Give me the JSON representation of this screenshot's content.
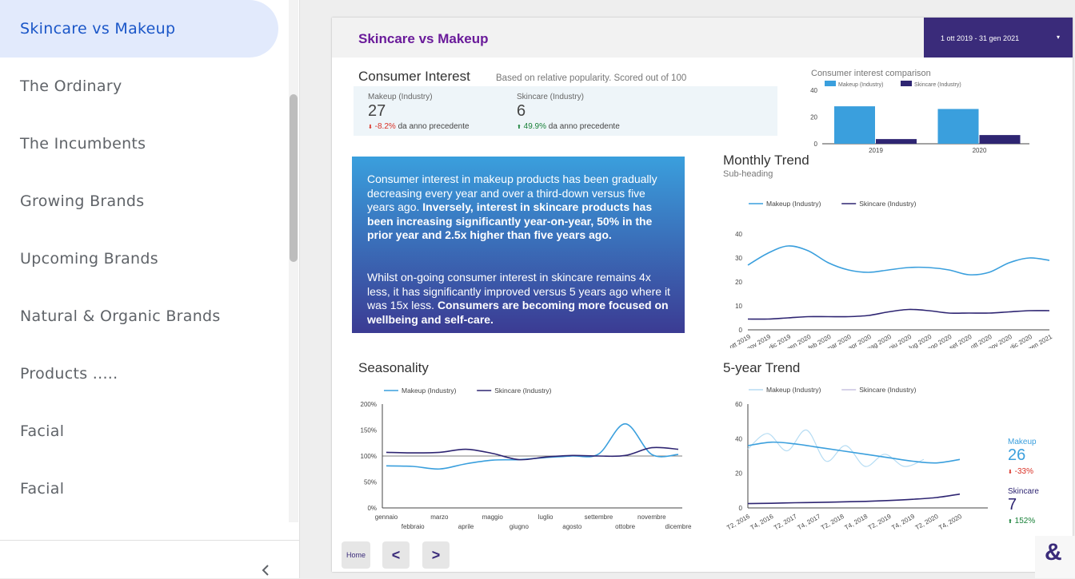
{
  "sidebar": {
    "items": [
      {
        "label": "Skincare vs Makeup",
        "active": true
      },
      {
        "label": "The Ordinary"
      },
      {
        "label": "The Incumbents"
      },
      {
        "label": "Growing Brands"
      },
      {
        "label": "Upcoming Brands"
      },
      {
        "label": "Natural & Organic Brands"
      },
      {
        "label": "Products ....."
      },
      {
        "label": "Facial"
      },
      {
        "label": "Facial"
      }
    ],
    "collapse_icon": "chevron-left-icon"
  },
  "report": {
    "title": "Skincare vs Makeup",
    "date_range": "1 ott 2019 - 31 gen 2021",
    "date_arrow": "▾",
    "consumer_interest": {
      "title": "Consumer Interest",
      "subtitle": "Based on relative popularity. Scored out of 100",
      "makeup": {
        "label": "Makeup (Industry)",
        "value": "27",
        "arrow": "⬇",
        "change": "-8.2%",
        "suffix": "da anno precedente"
      },
      "skincare": {
        "label": "Skincare (Industry)",
        "value": "6",
        "arrow": "⬆",
        "change": "49.9%",
        "suffix": "da anno precedente"
      }
    },
    "insight": {
      "p1_normal": "Consumer interest in makeup products has been gradually decreasing every year and over a third-down versus five years ago.",
      "p1_bold": "Inversely, interest in skincare products has been increasing significantly year-on-year, 50% in the prior year and 2.5x higher than five years ago.",
      "p2_normal": "Whilst on-going consumer interest in skincare remains 4x less, it has significantly improved versus 5 years ago where it was 15x less.",
      "p2_bold": "Consumers are becoming more focused on wellbeing and self-care."
    },
    "buttons": {
      "home": "Home",
      "prev": "<",
      "next": ">"
    },
    "logo": "&",
    "five_year_kpis": {
      "makeup_label": "Makeup",
      "makeup_value": "26",
      "makeup_arrow": "⬇",
      "makeup_change": "-33%",
      "skincare_label": "Skincare",
      "skincare_value": "7",
      "skincare_arrow": "⬆",
      "skincare_change": "152%"
    }
  },
  "colors": {
    "makeup": "#3a9fdd",
    "skincare": "#2e2572",
    "accent": "#3a2b7a",
    "title": "#6a1b9a"
  },
  "chart_data": [
    {
      "type": "bar",
      "title": "Consumer interest comparison",
      "categories": [
        "2019",
        "2020"
      ],
      "series": [
        {
          "name": "Makeup (Industry)",
          "values": [
            28,
            26
          ]
        },
        {
          "name": "Skincare (Industry)",
          "values": [
            3.5,
            6.5
          ]
        }
      ],
      "yticks": [
        "0",
        "20",
        "40"
      ],
      "ylim": [
        0,
        40
      ],
      "legend": "top"
    },
    {
      "type": "line",
      "title": "Monthly Trend",
      "subtitle": "Sub-heading",
      "categories": [
        "ott 2019",
        "nov 2019",
        "dic 2019",
        "gen 2020",
        "feb 2020",
        "mar 2020",
        "apr 2020",
        "mag 2020",
        "giu 2020",
        "lug 2020",
        "ago 2020",
        "set 2020",
        "ott 2020",
        "nov 2020",
        "dic 2020",
        "gen 2021"
      ],
      "series": [
        {
          "name": "Makeup (Industry)",
          "values": [
            27,
            32,
            35,
            33,
            28,
            25,
            24,
            25,
            26,
            26,
            25,
            23,
            24,
            28,
            30,
            29
          ]
        },
        {
          "name": "Skincare (Industry)",
          "values": [
            4.5,
            4.5,
            5,
            5.5,
            5.5,
            5.5,
            6,
            7.5,
            8.5,
            8,
            7,
            7,
            7,
            7.5,
            8,
            8
          ]
        }
      ],
      "yticks": [
        "0",
        "10",
        "20",
        "30",
        "40"
      ],
      "ylim": [
        0,
        40
      ],
      "legend": "top"
    },
    {
      "type": "line",
      "title": "Seasonality",
      "categories": [
        "gennaio",
        "febbraio",
        "marzo",
        "aprile",
        "maggio",
        "giugno",
        "luglio",
        "agosto",
        "settembre",
        "ottobre",
        "novembre",
        "dicembre"
      ],
      "series": [
        {
          "name": "Makeup (Industry)",
          "values": [
            81,
            80,
            75,
            85,
            92,
            93,
            97,
            100,
            104,
            162,
            103,
            103
          ]
        },
        {
          "name": "Skincare (Industry)",
          "values": [
            107,
            106,
            107,
            113,
            105,
            93,
            98,
            101,
            100,
            101,
            116,
            113
          ]
        }
      ],
      "yticks": [
        "0%",
        "50%",
        "100%",
        "150%",
        "200%"
      ],
      "ylim": [
        0,
        200
      ],
      "legend": "top"
    },
    {
      "type": "line",
      "title": "5-year Trend",
      "categories": [
        "T2, 2016",
        "T4, 2016",
        "T2, 2017",
        "T4, 2017",
        "T2, 2018",
        "T4, 2018",
        "T2, 2019",
        "T4, 2019",
        "T2, 2020",
        "T4, 2020"
      ],
      "series": [
        {
          "name": "Makeup (Industry)",
          "values": [
            36,
            38,
            37,
            35,
            33,
            31,
            29,
            27,
            26,
            28
          ]
        },
        {
          "name": "Skincare (Industry)",
          "values": [
            2.5,
            2.7,
            3,
            3.2,
            3.5,
            3.8,
            4.3,
            5,
            6,
            8
          ]
        },
        {
          "name": "Makeup (Industry) raw",
          "values": [
            34,
            43,
            33,
            45,
            27,
            36,
            24,
            31,
            24,
            28
          ]
        }
      ],
      "legend_labels": [
        "Makeup (Industry)",
        "Skincare (Industry)"
      ],
      "yticks": [
        "0",
        "20",
        "40",
        "60"
      ],
      "ylim": [
        0,
        60
      ],
      "legend": "top"
    }
  ]
}
